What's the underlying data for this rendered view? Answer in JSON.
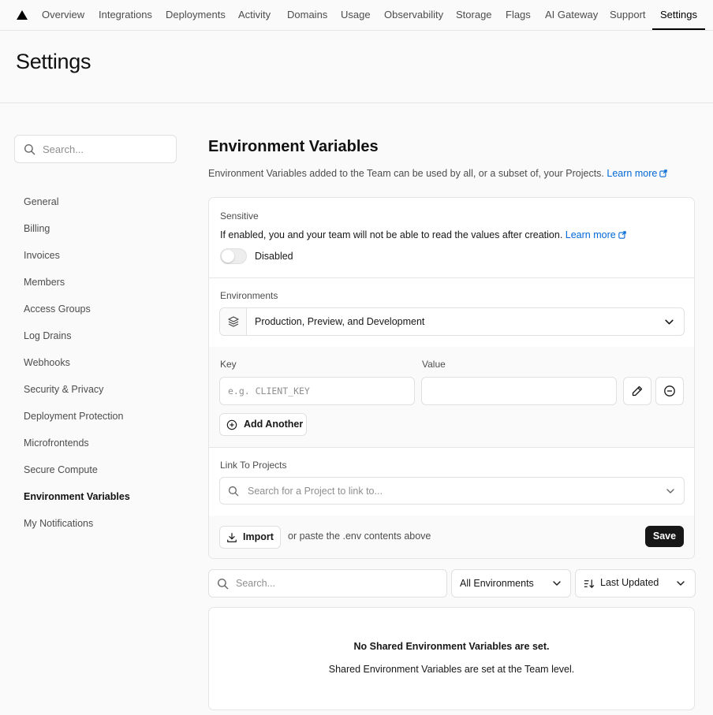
{
  "nav": {
    "tabs": [
      {
        "label": "Overview"
      },
      {
        "label": "Integrations"
      },
      {
        "label": "Deployments"
      },
      {
        "label": "Activity"
      },
      {
        "label": "Domains"
      },
      {
        "label": "Usage"
      },
      {
        "label": "Observability"
      },
      {
        "label": "Storage"
      },
      {
        "label": "Flags"
      },
      {
        "label": "AI Gateway"
      },
      {
        "label": "Support"
      },
      {
        "label": "Settings"
      }
    ],
    "active_tab": "Settings"
  },
  "header": {
    "title": "Settings"
  },
  "sidebar": {
    "search_placeholder": "Search...",
    "items": [
      {
        "label": "General"
      },
      {
        "label": "Billing"
      },
      {
        "label": "Invoices"
      },
      {
        "label": "Members"
      },
      {
        "label": "Access Groups"
      },
      {
        "label": "Log Drains"
      },
      {
        "label": "Webhooks"
      },
      {
        "label": "Security & Privacy"
      },
      {
        "label": "Deployment Protection"
      },
      {
        "label": "Microfrontends"
      },
      {
        "label": "Secure Compute"
      },
      {
        "label": "Environment Variables"
      },
      {
        "label": "My Notifications"
      }
    ],
    "active_item": "Environment Variables"
  },
  "main": {
    "title": "Environment Variables",
    "description": "Environment Variables added to the Team can be used by all, or a subset of, your Projects.",
    "learn_more": "Learn more",
    "sensitive": {
      "label": "Sensitive",
      "description": "If enabled, you and your team will not be able to read the values after creation.",
      "learn_more": "Learn more",
      "toggle_state": "Disabled"
    },
    "environments": {
      "label": "Environments",
      "selected": "Production, Preview, and Development"
    },
    "key_label": "Key",
    "key_placeholder": "e.g. CLIENT_KEY",
    "value_label": "Value",
    "value": "",
    "add_another": "Add Another",
    "link_projects": {
      "label": "Link To Projects",
      "placeholder": "Search for a Project to link to..."
    },
    "import_label": "Import",
    "paste_hint": "or paste the .env contents above",
    "save_label": "Save"
  },
  "filters": {
    "search_placeholder": "Search...",
    "environment_filter": "All Environments",
    "sort": "Last Updated"
  },
  "empty_state": {
    "title": "No Shared Environment Variables are set.",
    "subtitle": "Shared Environment Variables are set at the Team level."
  },
  "colors": {
    "accent_link": "#0068d6",
    "primary_button": "#171717"
  }
}
